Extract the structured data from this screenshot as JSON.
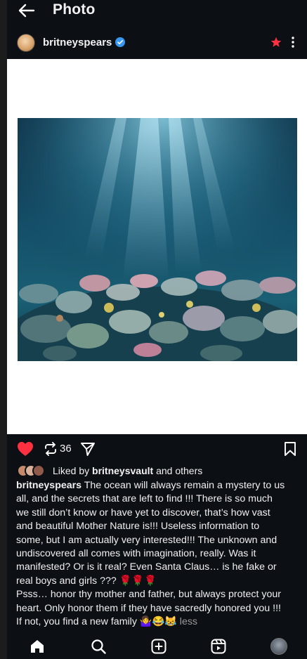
{
  "header": {
    "title": "Photo",
    "back_icon": "back-arrow-icon"
  },
  "profile": {
    "username": "britneyspears",
    "verified_icon": "verified-badge-icon",
    "star_icon": "star-icon",
    "menu_icon": "more-vertical-icon"
  },
  "post": {
    "image_description_icon": "post-image"
  },
  "actions": {
    "repost_count": "36",
    "liked": true,
    "like_color": "#ff3040"
  },
  "likes": {
    "prefix": "Liked by ",
    "user": "britneysvault",
    "suffix": " and others"
  },
  "caption": {
    "username": "britneyspears",
    "first_line_rest": " The ocean will always remain a mystery to us",
    "lines": [
      "all, and the secrets that are left to find !!! There is so much",
      "we still don’t know or have yet to discover, that’s how vast",
      "and beautiful Mother Nature is!!! Useless information to",
      "some, but I am actually very interested!!! The unknown and",
      "undiscovered all comes with imagination, really. Was it",
      "manifested? Or is it real? Even Santa Claus… is he fake or",
      "real boys and girls ???  🌹🌹🌹",
      "Psss… honor thy mother and father, but always protect your",
      "heart. Only honor them if they have sacredly honored you !!!"
    ],
    "last_line": "If not, you find a new family 🤷‍♀️😂😹 ",
    "less_label": "less"
  },
  "nav": {
    "items": [
      "home-icon",
      "search-icon",
      "create-icon",
      "reels-icon",
      "profile-avatar"
    ]
  }
}
